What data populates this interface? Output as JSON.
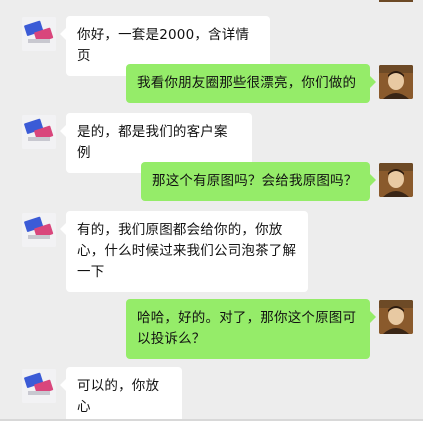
{
  "chat": {
    "messages": [
      {
        "side": "in",
        "text": "你好，一套是2000，含详情页"
      },
      {
        "side": "out",
        "text": "我看你朋友圈那些很漂亮，你们做的"
      },
      {
        "side": "in",
        "text": "是的，都是我们的客户案例"
      },
      {
        "side": "out",
        "text": "那这个有原图吗？会给我原图吗？"
      },
      {
        "side": "in",
        "text": "有的，我们原图都会给你的，你放心，什么时候过来我们公司泡茶了解一下"
      },
      {
        "side": "out",
        "text": "哈哈，好的。对了，那你这个原图可以投诉么？"
      },
      {
        "side": "in",
        "text": "可以的，你放心"
      }
    ]
  },
  "colors": {
    "background": "#ededed",
    "incoming_bubble": "#ffffff",
    "outgoing_bubble": "#95ec69"
  },
  "icons": {
    "contact_avatar": "phone-mockup-avatar-icon",
    "self_avatar": "portrait-avatar-icon"
  }
}
